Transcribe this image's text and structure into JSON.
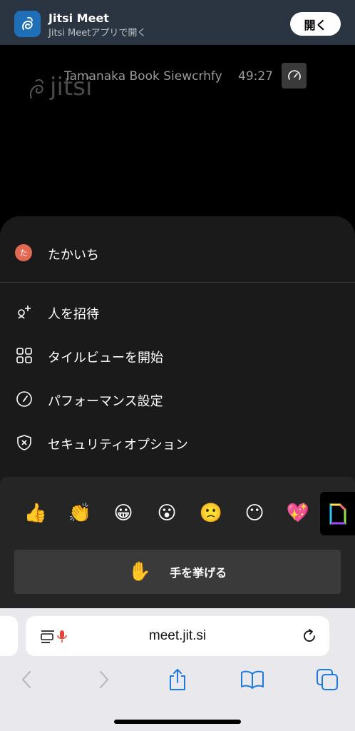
{
  "banner": {
    "app_icon": "jitsi-app-icon",
    "title": "Jitsi Meet",
    "subtitle": "Jitsi Meetアプリで開く",
    "open_label": "開く"
  },
  "meeting": {
    "watermark": "jitsi",
    "name": "Tamanaka Book Siewcrhfy",
    "time": "49:27",
    "performance_icon": "speedometer-icon"
  },
  "sheet": {
    "user": {
      "avatar_letter": "た",
      "name": "たかいち",
      "avatar_color": "#e26a54"
    },
    "menu": [
      {
        "icon": "invite-person-icon",
        "label": "人を招待"
      },
      {
        "icon": "tile-view-icon",
        "label": "タイルビューを開始"
      },
      {
        "icon": "speedometer-icon",
        "label": "パフォーマンス設定"
      },
      {
        "icon": "shield-x-icon",
        "label": "セキュリティオプション"
      }
    ]
  },
  "reactions": {
    "emojis": [
      "👍",
      "👏",
      "😀",
      "😮",
      "🙁",
      "😶",
      "💖"
    ],
    "gif_icon": "gif-icon",
    "raise_hand_emoji": "✋",
    "raise_hand_label": "手を挙げる"
  },
  "browser": {
    "url": "meet.jit.si",
    "reader_icon": "reader-mic-icon",
    "reload_icon": "reload-icon",
    "nav": [
      "back-icon",
      "forward-icon",
      "share-icon",
      "bookmarks-icon",
      "tabs-icon"
    ]
  },
  "colors": {
    "banner_bg": "#2b3542",
    "sheet_bg": "#1a1a1a",
    "reactions_bg": "#252525",
    "browser_bg": "#e9e9ed",
    "link_blue": "#1f7ae0"
  }
}
